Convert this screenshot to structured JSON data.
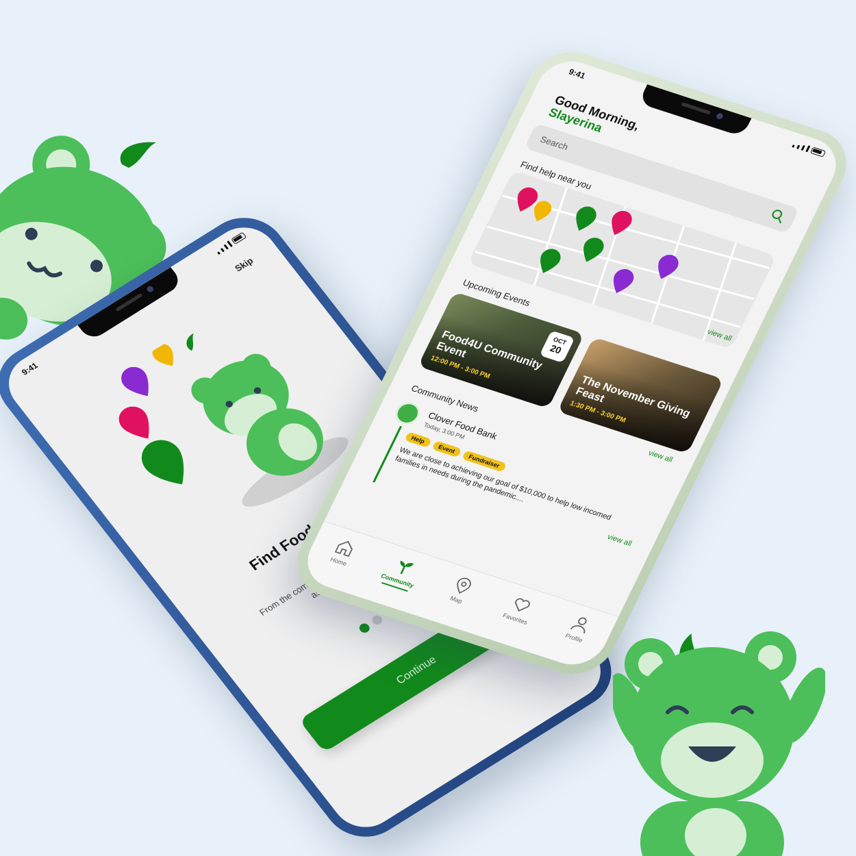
{
  "colors": {
    "brand_green": "#118a1b",
    "mascot_green": "#4cbf5a",
    "tag_yellow": "#f1c21b",
    "background": "#e8f1f9"
  },
  "onboarding": {
    "status_time": "9:41",
    "skip_label": "Skip",
    "title": "Find Food Re Near",
    "description": "From the comfort o you can find thousands o assistance near yo",
    "continue_label": "Continue",
    "page_count": 3,
    "active_page": 1
  },
  "home": {
    "status_time": "9:41",
    "greeting": "Good Morning,",
    "user_name": "Slayerina",
    "search_placeholder": "Search",
    "find_help_title": "Find help near you",
    "view_all_label": "view all",
    "upcoming_events_title": "Upcoming Events",
    "events": [
      {
        "name": "Food4U Community Event",
        "time": "12:00 PM - 3:00 PM",
        "month": "OCT",
        "day": "20"
      },
      {
        "name": "The November Giving Feast",
        "time": "1:30 PM - 3:00 PM",
        "month": "",
        "day": ""
      }
    ],
    "community_news_title": "Community News",
    "news": {
      "org": "Clover Food Bank",
      "time": "Today, 3:00 PM",
      "tags": [
        "Help",
        "Event",
        "Fundraiser"
      ],
      "body": "We are close to achieving our goal of $10,000 to help low incomed families in needs during the pandemic...."
    },
    "tabs": [
      {
        "label": "Home",
        "icon": "home-icon"
      },
      {
        "label": "Community",
        "icon": "sprout-icon"
      },
      {
        "label": "Map",
        "icon": "map-pin-icon"
      },
      {
        "label": "Favorites",
        "icon": "heart-icon"
      },
      {
        "label": "Profile",
        "icon": "person-icon"
      }
    ],
    "active_tab": "Community"
  }
}
